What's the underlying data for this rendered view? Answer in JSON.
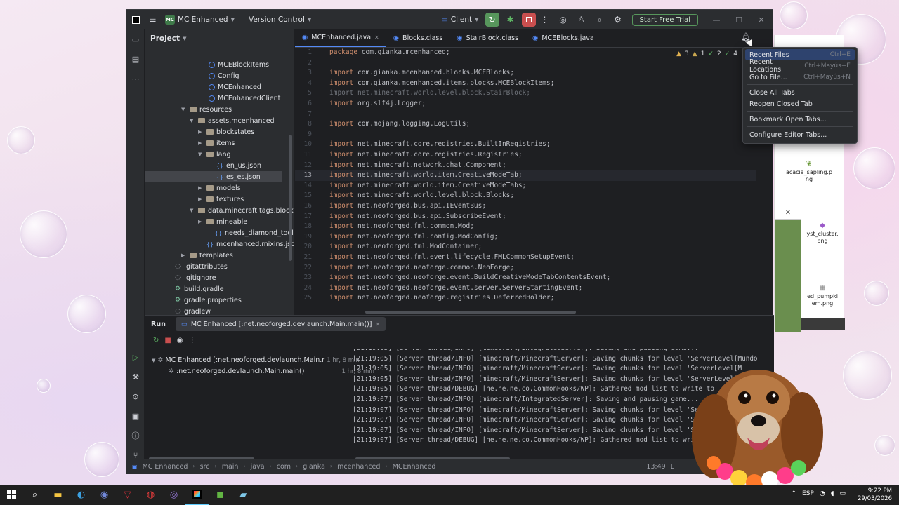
{
  "window": {
    "project_badge": "MC",
    "project_name": "MC Enhanced",
    "vcs_label": "Version Control",
    "run_config": "Client",
    "trial_button": "Start Free Trial"
  },
  "project_panel": {
    "title": "Project",
    "tree": [
      {
        "label": "MCEBlockItems",
        "type": "class"
      },
      {
        "label": "Config",
        "type": "class"
      },
      {
        "label": "MCEnhanced",
        "type": "class"
      },
      {
        "label": "MCEnhancedClient",
        "type": "class"
      },
      {
        "label": "resources",
        "type": "folder"
      },
      {
        "label": "assets.mcenhanced",
        "type": "folder"
      },
      {
        "label": "blockstates",
        "type": "folder"
      },
      {
        "label": "items",
        "type": "folder"
      },
      {
        "label": "lang",
        "type": "folder"
      },
      {
        "label": "en_us.json",
        "type": "json"
      },
      {
        "label": "es_es.json",
        "type": "json"
      },
      {
        "label": "models",
        "type": "folder"
      },
      {
        "label": "textures",
        "type": "folder"
      },
      {
        "label": "data.minecraft.tags.block",
        "type": "folder"
      },
      {
        "label": "mineable",
        "type": "folder"
      },
      {
        "label": "needs_diamond_tool.json",
        "type": "json"
      },
      {
        "label": "mcenhanced.mixins.json",
        "type": "json"
      },
      {
        "label": "templates",
        "type": "folder"
      },
      {
        "label": ".gitattributes",
        "type": "file"
      },
      {
        "label": ".gitignore",
        "type": "file"
      },
      {
        "label": "build.gradle",
        "type": "gradle"
      },
      {
        "label": "gradle.properties",
        "type": "gradle"
      },
      {
        "label": "gradlew",
        "type": "file"
      }
    ]
  },
  "editor": {
    "tabs": [
      {
        "label": "MCEnhanced.java",
        "active": true
      },
      {
        "label": "Blocks.class",
        "active": false
      },
      {
        "label": "StairBlock.class",
        "active": false
      },
      {
        "label": "MCEBlocks.java",
        "active": false
      }
    ],
    "inspections": {
      "warnings": "3",
      "weak": "1",
      "ok": "2",
      "typos": "4"
    },
    "lines": [
      {
        "n": "1",
        "kw": "package",
        "rest": " com.gianka.mcenhanced;"
      },
      {
        "n": "2",
        "kw": "",
        "rest": ""
      },
      {
        "n": "3",
        "kw": "import",
        "rest": " com.gianka.mcenhanced.blocks.MCEBlocks;"
      },
      {
        "n": "4",
        "kw": "import",
        "rest": " com.gianka.mcenhanced.items.blocks.MCEBlockItems;"
      },
      {
        "n": "5",
        "kw": "import",
        "rest": " net.minecraft.world.level.block.StairBlock;",
        "dim": true
      },
      {
        "n": "6",
        "kw": "import",
        "rest": " org.slf4j.Logger;"
      },
      {
        "n": "7",
        "kw": "",
        "rest": ""
      },
      {
        "n": "8",
        "kw": "import",
        "rest": " com.mojang.logging.LogUtils;"
      },
      {
        "n": "9",
        "kw": "",
        "rest": ""
      },
      {
        "n": "10",
        "kw": "import",
        "rest": " net.minecraft.core.registries.BuiltInRegistries;"
      },
      {
        "n": "11",
        "kw": "import",
        "rest": " net.minecraft.core.registries.Registries;"
      },
      {
        "n": "12",
        "kw": "import",
        "rest": " net.minecraft.network.chat.Component;"
      },
      {
        "n": "13",
        "kw": "import",
        "rest": " net.minecraft.world.item.CreativeModeTab;",
        "current": true
      },
      {
        "n": "14",
        "kw": "import",
        "rest": " net.minecraft.world.item.CreativeModeTabs;"
      },
      {
        "n": "15",
        "kw": "import",
        "rest": " net.minecraft.world.level.block.Blocks;"
      },
      {
        "n": "16",
        "kw": "import",
        "rest": " net.neoforged.bus.api.IEventBus;"
      },
      {
        "n": "17",
        "kw": "import",
        "rest": " net.neoforged.bus.api.SubscribeEvent;"
      },
      {
        "n": "18",
        "kw": "import",
        "rest": " net.neoforged.fml.common.Mod;"
      },
      {
        "n": "19",
        "kw": "import",
        "rest": " net.neoforged.fml.config.ModConfig;"
      },
      {
        "n": "20",
        "kw": "import",
        "rest": " net.neoforged.fml.ModContainer;"
      },
      {
        "n": "21",
        "kw": "import",
        "rest": " net.neoforged.fml.event.lifecycle.FMLCommonSetupEvent;"
      },
      {
        "n": "22",
        "kw": "import",
        "rest": " net.neoforged.neoforge.common.NeoForge;"
      },
      {
        "n": "23",
        "kw": "import",
        "rest": " net.neoforged.neoforge.event.BuildCreativeModeTabContentsEvent;"
      },
      {
        "n": "24",
        "kw": "import",
        "rest": " net.neoforged.neoforge.event.server.ServerStartingEvent;"
      },
      {
        "n": "25",
        "kw": "import",
        "rest": " net.neoforged.neoforge.registries.DeferredHolder;"
      }
    ]
  },
  "run_panel": {
    "title": "Run",
    "tab_label": "MC Enhanced [:net.neoforged.devlaunch.Main.main()]",
    "tree": [
      {
        "label": "MC Enhanced [:net.neoforged.devlaunch.Main.r",
        "time": "1 hr, 8 min"
      },
      {
        "label": ":net.neoforged.devlaunch.Main.main()",
        "time": "1 hr, 8 min"
      }
    ],
    "log": [
      "[21:19:05] [Server thread/INFO] [minecraft/IntegratedServer]: Saving and pausing game...",
      "[21:19:05] [Server thread/INFO] [minecraft/MinecraftServer]: Saving chunks for level 'ServerLevel[Mundo",
      "[21:19:05] [Server thread/INFO] [minecraft/MinecraftServer]: Saving chunks for level 'ServerLevel[M",
      "[21:19:05] [Server thread/INFO] [minecraft/MinecraftServer]: Saving chunks for level 'ServerLevel[",
      "[21:19:05] [Server thread/DEBUG] [ne.ne.ne.co.CommonHooks/WP]: Gathered mod list to write to",
      "[21:19:07] [Server thread/INFO] [minecraft/IntegratedServer]: Saving and pausing game...",
      "[21:19:07] [Server thread/INFO] [minecraft/MinecraftServer]: Saving chunks for level 'Serve",
      "[21:19:07] [Server thread/INFO] [minecraft/MinecraftServer]: Saving chunks for level 'Serve",
      "[21:19:07] [Server thread/INFO] [minecraft/MinecraftServer]: Saving chunks for level 'Ser",
      "[21:19:07] [Server thread/DEBUG] [ne.ne.ne.co.CommonHooks/WP]: Gathered mod list to write t"
    ]
  },
  "statusbar": {
    "crumbs": [
      "MC Enhanced",
      "src",
      "main",
      "java",
      "com",
      "gianka",
      "mcenhanced",
      "MCEnhanced"
    ],
    "position": "13:49",
    "extra": "L"
  },
  "popup_menu": {
    "items": [
      {
        "label": "Recent Files",
        "shortcut": "Ctrl+E",
        "highlight": true
      },
      {
        "label": "Recent Locations",
        "shortcut": "Ctrl+Mayús+E"
      },
      {
        "label": "Go to File...",
        "shortcut": "Ctrl+Mayús+N"
      },
      {
        "label": "Close All Tabs",
        "shortcut": ""
      },
      {
        "label": "Reopen Closed Tab",
        "shortcut": ""
      },
      {
        "label": "Bookmark Open Tabs...",
        "shortcut": ""
      },
      {
        "label": "Configure Editor Tabs...",
        "shortcut": ""
      }
    ]
  },
  "file_explorer": {
    "items": [
      "acacia_sapling.p\nng",
      "yst_cluster.\npng",
      "ed_pumpki\nem.png"
    ]
  },
  "taskbar": {
    "language": "ESP",
    "time": "9:22 PM",
    "date": "29/03/2026"
  },
  "colors": {
    "accent": "#548af7",
    "keyword": "#cf8e6d",
    "editor_bg": "#1e1f22",
    "panel_bg": "#2b2d30",
    "popup_highlight": "#2e436e",
    "trial_border": "#57965c"
  }
}
